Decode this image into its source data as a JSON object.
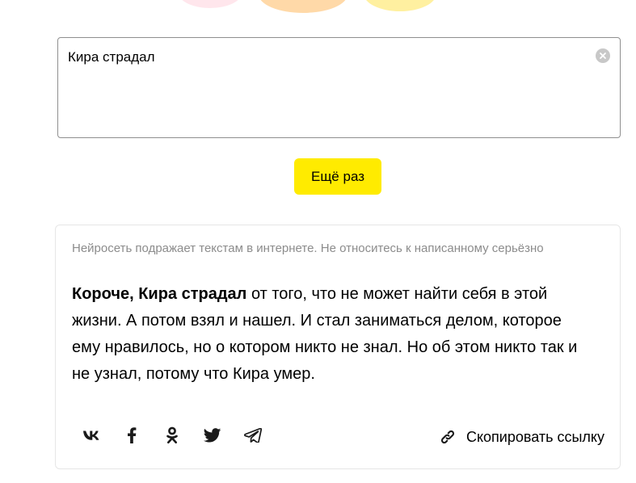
{
  "query": {
    "value": "Кира страдал",
    "clear_icon": "clear-icon"
  },
  "actions": {
    "again_label": "Ещё раз"
  },
  "result": {
    "disclaimer": "Нейросеть подражает текстам в интернете. Не относитесь к написанному серьёзно",
    "lead_bold": "Короче, Кира страдал",
    "body": " от того, что не может найти себя в этой жизни. А потом взял и нашел. И стал заниматься делом, которое ему нравилось, но о котором никто не знал. Но об этом никто так и не узнал, потому что Кира умер."
  },
  "share": {
    "icons": [
      "vk-icon",
      "facebook-icon",
      "odnoklassniki-icon",
      "twitter-icon",
      "telegram-icon"
    ],
    "copy_label": "Скопировать ссылку",
    "copy_icon": "link-icon"
  },
  "colors": {
    "accent_button": "#ffeb00",
    "disclaimer_text": "#8c8c8c",
    "input_border": "#8f8f8f",
    "card_border": "#e6e6e6"
  }
}
